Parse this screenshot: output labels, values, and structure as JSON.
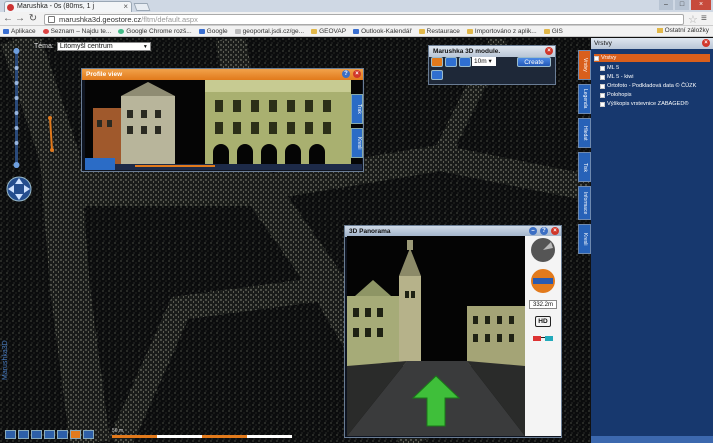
{
  "browser": {
    "tab_title": "Marushka - 0s (80ms, 1 j",
    "tab_close": "×",
    "window_buttons": [
      "–",
      "□",
      "×"
    ],
    "url_host": "marushka3d.geostore.cz",
    "url_path": "/fltm/default.aspx",
    "bookmarks": [
      {
        "label": "Aplikace",
        "icon": "apps-icon"
      },
      {
        "label": "Seznam – Najdu te...",
        "icon": "seznam-icon"
      },
      {
        "label": "Google Chrome rozš...",
        "icon": "chrome-icon"
      },
      {
        "label": "Google",
        "icon": "google-icon"
      },
      {
        "label": "geoportal.jsdi.cz/ge...",
        "icon": "page-icon"
      },
      {
        "label": "GEOVAP",
        "icon": "folder-icon"
      },
      {
        "label": "Outlook-Kalendář",
        "icon": "outlook-icon"
      },
      {
        "label": "Restaurace",
        "icon": "folder-icon"
      },
      {
        "label": "Importováno z aplik...",
        "icon": "folder-icon"
      },
      {
        "label": "GIS",
        "icon": "folder-icon"
      }
    ],
    "other_bookmarks": "Ostatní záložky"
  },
  "map": {
    "topic_label": "Téma:",
    "topic_value": "Litomyšl centrum",
    "vertical_logo": "Marushka3D",
    "scale_text": "50 m"
  },
  "profile_window": {
    "title": "Profile view",
    "tabs": [
      "Trak",
      "Kresli"
    ]
  },
  "module_window": {
    "title": "Marushka 3D module.",
    "distance_value": "10m",
    "create_label": "Create"
  },
  "panorama_window": {
    "title": "3D Panorama",
    "distance_readout": "332.2m",
    "hd_label": "HD"
  },
  "right_panel": {
    "title": "Vrstvy",
    "side_tabs": [
      "Vrstvy",
      "Legenda",
      "Hledat",
      "Tisk",
      "Informace",
      "Kresli"
    ],
    "layers": [
      {
        "label": "Vrstvy",
        "selected": true
      },
      {
        "label": "ML 5",
        "selected": false
      },
      {
        "label": "ML 5 - kiwi",
        "selected": false
      },
      {
        "label": "Ortofoto - Podkladová data © ČÚZK",
        "selected": false
      },
      {
        "label": "Polohopis",
        "selected": false
      },
      {
        "label": "Výškopis vrstevnice ZABAGED®",
        "selected": false
      }
    ]
  },
  "colors": {
    "accent_orange": "#e27a1c",
    "panel_blue": "#17386e",
    "button_blue": "#2f6fd0"
  }
}
